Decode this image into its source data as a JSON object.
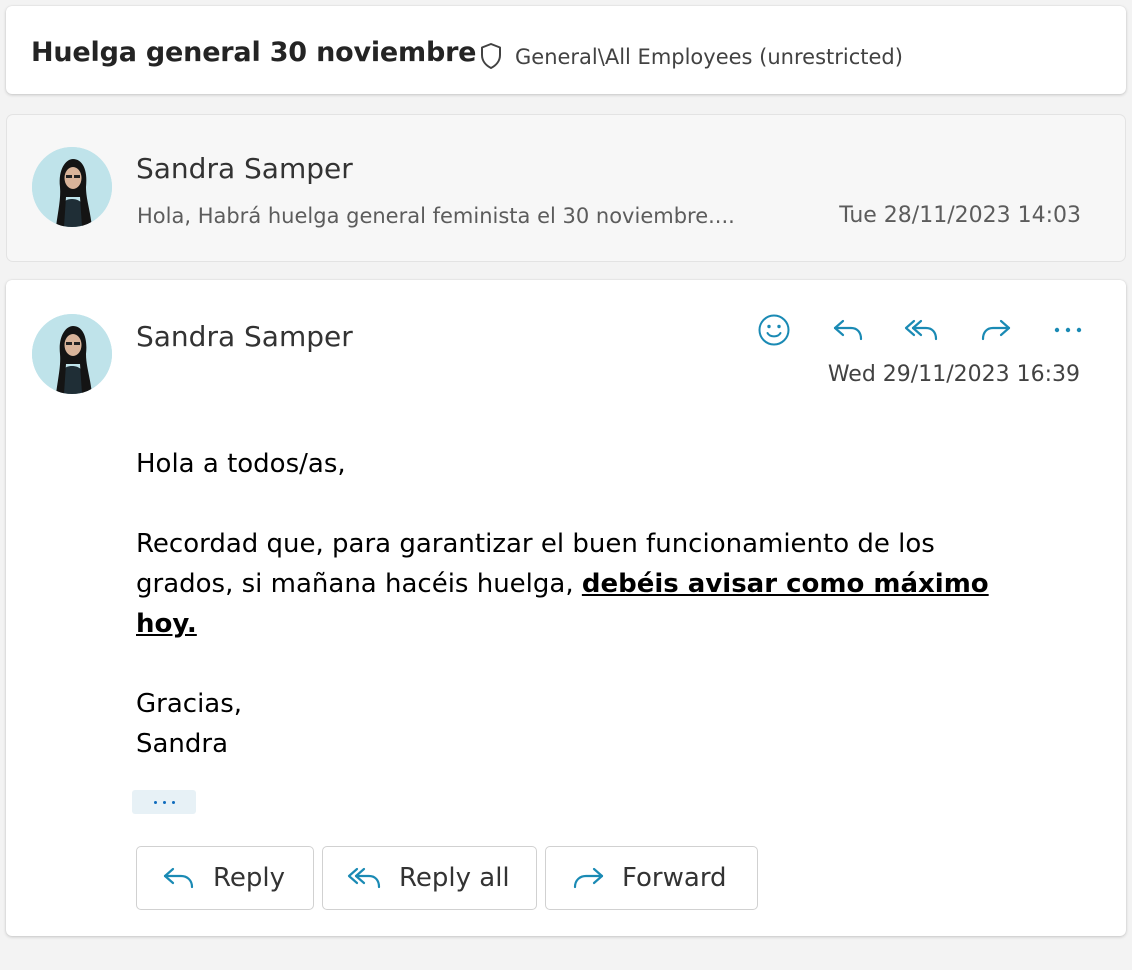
{
  "header": {
    "subject": "Huelga general 30 noviembre",
    "sensitivity_icon": "shield-icon",
    "sensitivity_label": "General\\All Employees (unrestricted)"
  },
  "messages": [
    {
      "state": "collapsed",
      "sender": "Sandra Samper",
      "preview": "Hola, Habrá huelga general feminista el 30 noviembre....",
      "date": "Tue 28/11/2023 14:03"
    },
    {
      "state": "expanded",
      "sender": "Sandra Samper",
      "date": "Wed 29/11/2023 16:39",
      "actions": [
        "smiley-icon",
        "reply-icon",
        "reply-all-icon",
        "forward-icon",
        "more-icon"
      ],
      "body": {
        "greeting": "Hola a todos/as,",
        "paragraph_start": "Recordad que, para garantizar el buen funcionamiento de los grados, si mañana hacéis huelga, ",
        "paragraph_emphasis": "debéis avisar como máximo hoy.",
        "closing": "Gracias,",
        "signature": "Sandra"
      },
      "buttons": {
        "reply": "Reply",
        "reply_all": "Reply all",
        "forward": "Forward"
      }
    }
  ],
  "colors": {
    "accent": "#0f6cbd",
    "icon_blue": "#1a8ab4",
    "background": "#f3f3f3"
  }
}
